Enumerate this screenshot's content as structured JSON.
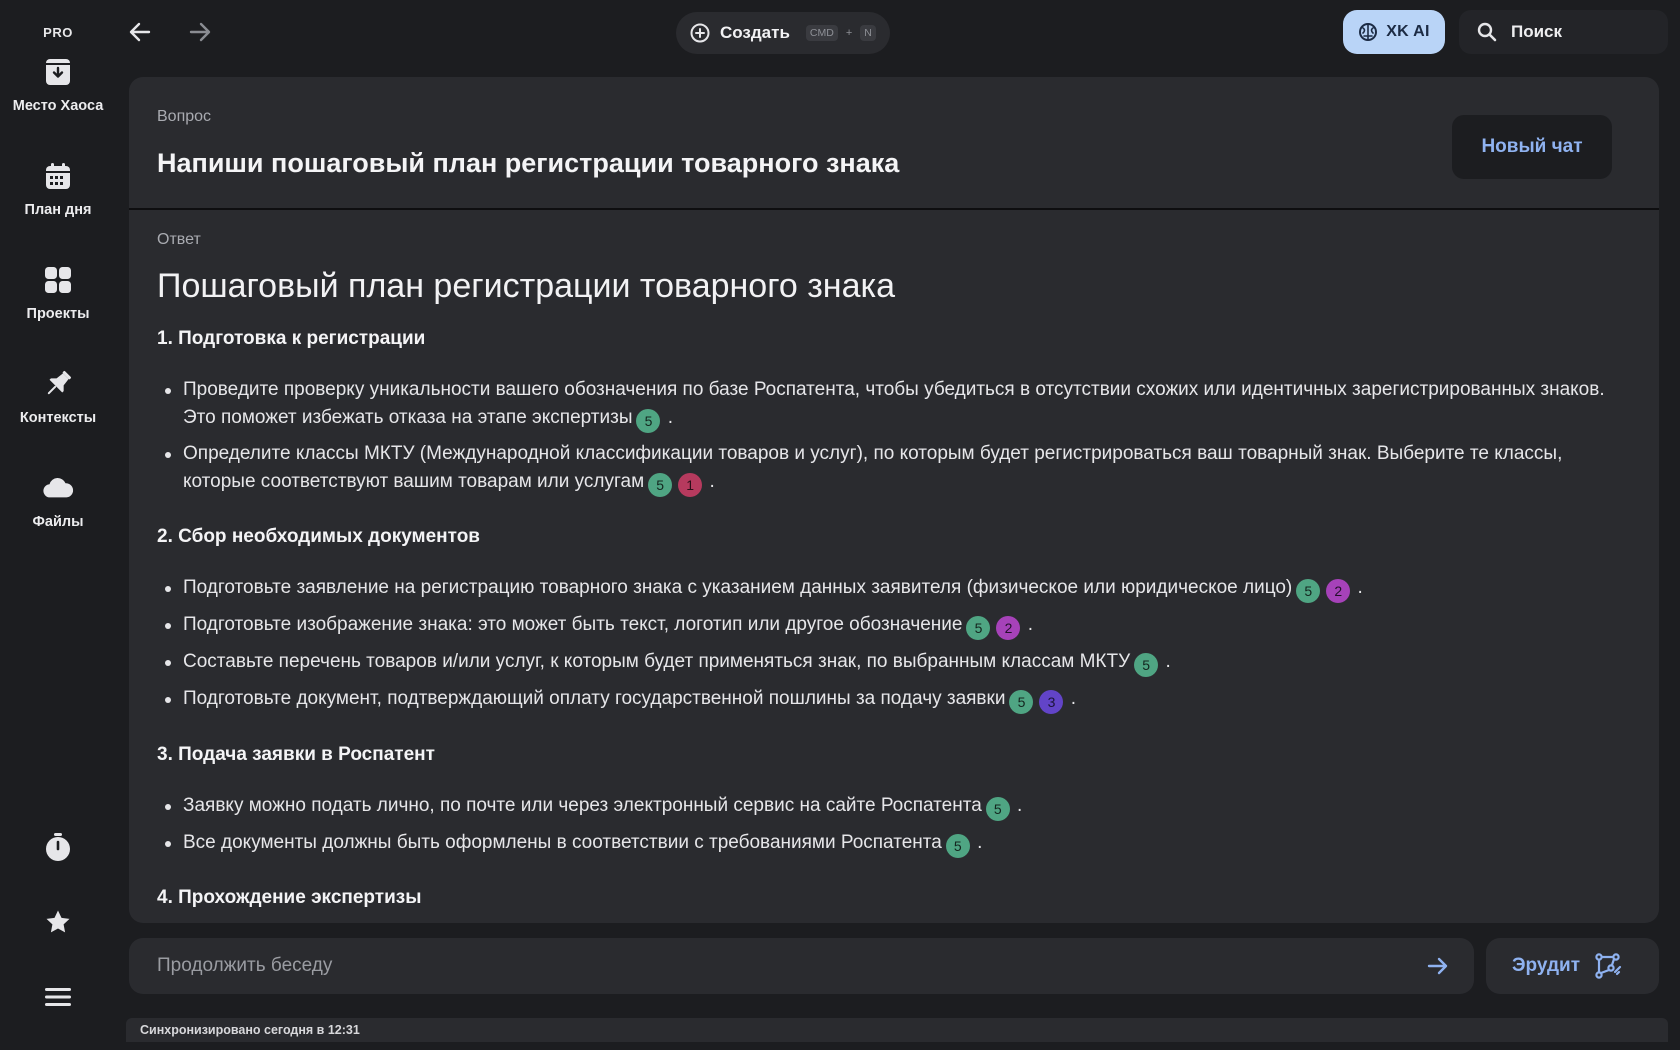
{
  "sidebar": {
    "badge": "PRO",
    "items": [
      {
        "label": "Место Хаоса",
        "icon": "inbox-download-icon"
      },
      {
        "label": "План дня",
        "icon": "calendar-icon"
      },
      {
        "label": "Проекты",
        "icon": "grid-icon"
      },
      {
        "label": "Контексты",
        "icon": "pin-icon"
      },
      {
        "label": "Файлы",
        "icon": "cloud-icon"
      }
    ],
    "bottom_icons": [
      "timer-icon",
      "star-icon",
      "menu-icon"
    ]
  },
  "topbar": {
    "create_label": "Создать",
    "shortcut_key1": "CMD",
    "shortcut_plus": "+",
    "shortcut_key2": "N",
    "ai_label": "XK AI",
    "search_label": "Поиск"
  },
  "question": {
    "label": "Вопрос",
    "title": "Напиши пошаговый план регистрации товарного знака",
    "new_chat": "Новый чат"
  },
  "answer": {
    "label": "Ответ",
    "title": "Пошаговый план регистрации товарного знака",
    "steps": [
      {
        "title": "1. Подготовка к регистрации",
        "bullets": [
          {
            "text": "Проведите проверку уникальности вашего обозначения по базе Роспатента, чтобы убедиться в отсутствии схожих или идентичных зарегистрированных знаков. Это поможет избежать отказа на этапе экспертизы",
            "refs": [
              "5"
            ]
          },
          {
            "text": "Определите классы МКТУ (Международной классификации товаров и услуг), по которым будет регистрироваться ваш товарный знак. Выберите те классы, которые соответствуют вашим товарам или услугам",
            "refs": [
              "5",
              "1"
            ]
          }
        ]
      },
      {
        "title": "2. Сбор необходимых документов",
        "bullets": [
          {
            "text": "Подготовьте заявление на регистрацию товарного знака с указанием данных заявителя (физическое или юридическое лицо)",
            "refs": [
              "5",
              "2"
            ]
          },
          {
            "text": "Подготовьте изображение знака: это может быть текст, логотип или другое обозначение",
            "refs": [
              "5",
              "2"
            ]
          },
          {
            "text": "Составьте перечень товаров и/или услуг, к которым будет применяться знак, по выбранным классам МКТУ",
            "refs": [
              "5"
            ]
          },
          {
            "text": "Подготовьте документ, подтверждающий оплату государственной пошлины за подачу заявки",
            "refs": [
              "5",
              "3"
            ]
          }
        ]
      },
      {
        "title": "3. Подача заявки в Роспатент",
        "bullets": [
          {
            "text": "Заявку можно подать лично, по почте или через электронный сервис на сайте Роспатента",
            "refs": [
              "5"
            ]
          },
          {
            "text": "Все документы должны быть оформлены в соответствии с требованиями Роспатента",
            "refs": [
              "5"
            ]
          }
        ]
      },
      {
        "title": "4. Прохождение экспертизы",
        "bullets": []
      }
    ]
  },
  "composer": {
    "placeholder": "Продолжить беседу",
    "mode_label": "Эрудит"
  },
  "status": "Синхронизировано сегодня в 12:31",
  "colors": {
    "accent": "#8fb2f0",
    "ai_button": "#b9d4f7",
    "ref_5": "#4fa583",
    "ref_1": "#b63a5e",
    "ref_2": "#a642b9",
    "ref_3": "#6244c8"
  }
}
